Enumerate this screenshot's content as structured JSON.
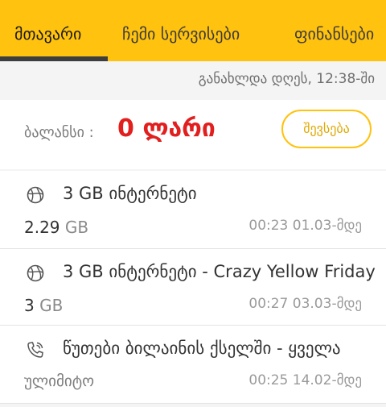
{
  "tabs": [
    {
      "label": "მთავარი",
      "active": true
    },
    {
      "label": "ჩემი სერვისები",
      "active": false
    },
    {
      "label": "ფინანსები",
      "active": false
    }
  ],
  "updated": {
    "text": "განახლდა დღეს, 12:38-ში"
  },
  "balance": {
    "label": "ბალანსი :",
    "value": "0 ლარი",
    "topup_label": "შევსება"
  },
  "items": [
    {
      "icon": "globe-icon",
      "title": "3 GB ინტერნეტი",
      "amount": "2.29",
      "unit": "GB",
      "expiry": "00:23 01.03-მდე"
    },
    {
      "icon": "globe-icon",
      "title": "3 GB ინტერნეტი - Crazy Yellow Friday",
      "amount": "3",
      "unit": "GB",
      "expiry": "00:27 03.03-მდე"
    },
    {
      "icon": "phone-icon",
      "title": "წუთები ბილაინის ქსელში - ყველა",
      "amount_text": "ულიმიტო",
      "expiry": "00:25 14.02-მდე"
    }
  ],
  "colors": {
    "brand_yellow": "#ffc20e",
    "balance_red": "#e21f1f"
  }
}
